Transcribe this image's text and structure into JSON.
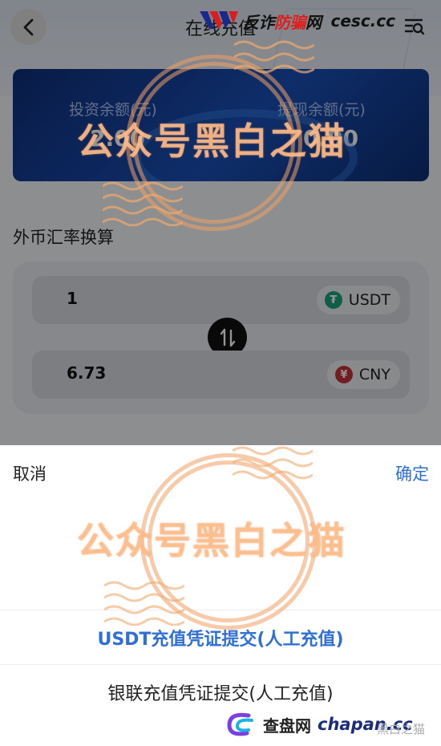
{
  "header": {
    "title": "在线充值",
    "back_icon": "back-chevron-icon",
    "record_icon": "list-search-icon"
  },
  "balance": {
    "invest_label": "投资余额(元)",
    "invest_value": "2.00",
    "withdraw_label": "提现余额(元)",
    "withdraw_value": "0.00"
  },
  "converter": {
    "title": "外币汇率换算",
    "from_value": "1",
    "from_currency": "USDT",
    "to_value": "6.73",
    "to_currency": "CNY",
    "usdt_color": "#1ba27a",
    "cny_color": "#c8333a"
  },
  "sheet": {
    "cancel": "取消",
    "confirm": "确定",
    "options": [
      {
        "label": "USDT充值凭证提交(人工充值)",
        "selected": true
      },
      {
        "label": "银联充值凭证提交(人工充值)",
        "selected": false
      }
    ]
  },
  "watermarks": {
    "stamp_text": "公众号黑白之猫",
    "top_logo_cn": "反诈",
    "top_logo_red": "防骗",
    "top_logo_cn2": "网",
    "top_logo_site": "cesc.cc",
    "bottom_logo_cn": "查盘网",
    "bottom_logo_site": "chapan.cc",
    "bottom_credit": "黑白之猫"
  },
  "colors": {
    "accent": "#2f6fd6",
    "card": "#1a4fb6"
  }
}
